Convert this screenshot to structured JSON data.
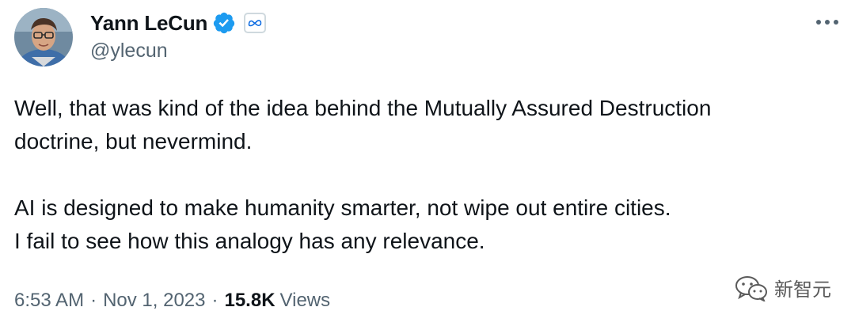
{
  "author": {
    "display_name": "Yann LeCun",
    "handle": "@ylecun",
    "verified": true,
    "affiliation_icon": "meta-logo-icon"
  },
  "tweet": {
    "paragraphs": [
      [
        "Well, that was kind of the idea behind the Mutually Assured Destruction",
        "doctrine, but nevermind."
      ],
      [
        "AI is designed to make humanity smarter, not wipe out entire cities.",
        "I fail to see how this analogy has any relevance."
      ]
    ]
  },
  "meta": {
    "time": "6:53 AM",
    "separator": "·",
    "date": "Nov 1, 2023",
    "views_count": "15.8K",
    "views_label": "Views"
  },
  "watermark": {
    "text": "新智元",
    "icon": "wechat-icon"
  },
  "colors": {
    "verified_blue": "#1d9bf0",
    "secondary_text": "#536471",
    "primary_text": "#0f1419"
  }
}
